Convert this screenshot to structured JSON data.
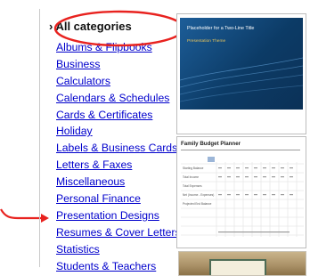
{
  "categories": {
    "heading": "› All categories",
    "items": [
      "Albums & Flipbooks",
      "Business",
      "Calculators",
      "Calendars & Schedules",
      "Cards & Certificates",
      "Holiday",
      "Labels & Business Cards",
      "Letters & Faxes",
      "Miscellaneous",
      "Personal Finance",
      "Presentation Designs",
      "Resumes & Cover Letters",
      "Statistics",
      "Students & Teachers"
    ]
  },
  "thumbnails": {
    "presentation": {
      "title": "Placeholder for a Two-Line Title",
      "subtitle": "Presentation Theme"
    },
    "budget": {
      "title": "Family Budget Planner",
      "row_labels": [
        "Starting Balance",
        "Total Income",
        "Total Expenses",
        "Net (Income - Expenses)",
        "Projected End Balance"
      ]
    }
  },
  "colors": {
    "highlight": "#e8221f",
    "link": "#0000cc",
    "slide_bg": "#0c3b66"
  }
}
